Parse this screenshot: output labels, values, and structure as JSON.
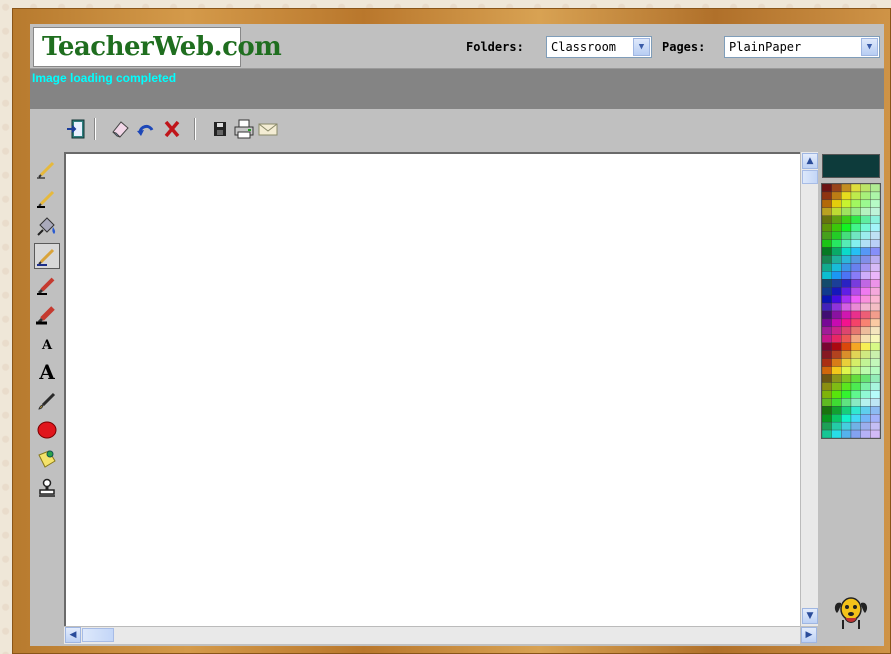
{
  "header": {
    "logo_text": "TeacherWeb.com",
    "folders_label": "Folders:",
    "folders_value": "Classroom",
    "pages_label": "Pages:",
    "pages_value": "PlainPaper"
  },
  "status": {
    "message": "Image loading completed"
  },
  "colors": {
    "status_text": "#00ffff",
    "current_color": "#0d3b3b",
    "logo_text": "#1f6e1f",
    "frame": "#c58a3e"
  },
  "toolbar": {
    "icons": [
      "exit-icon",
      "eraser-icon",
      "undo-icon",
      "clear-icon",
      "save-icon",
      "print-icon",
      "email-icon"
    ]
  },
  "tools": [
    {
      "name": "thin-pencil-tool",
      "icon": "pencil-icon"
    },
    {
      "name": "medium-pencil-tool",
      "icon": "pencil-icon"
    },
    {
      "name": "fill-tool",
      "icon": "paint-bucket-icon"
    },
    {
      "name": "pen-tool",
      "icon": "pen-icon",
      "selected": true
    },
    {
      "name": "marker-tool",
      "icon": "marker-icon"
    },
    {
      "name": "thick-marker-tool",
      "icon": "marker-icon"
    },
    {
      "name": "small-text-tool",
      "icon": "text-icon",
      "glyph": "A"
    },
    {
      "name": "large-text-tool",
      "icon": "text-icon",
      "glyph": "A"
    },
    {
      "name": "brush-tool",
      "icon": "brush-icon"
    },
    {
      "name": "circle-tool",
      "icon": "circle-icon"
    },
    {
      "name": "sticky-note-tool",
      "icon": "note-icon"
    },
    {
      "name": "stamp-tool",
      "icon": "stamp-icon"
    }
  ]
}
